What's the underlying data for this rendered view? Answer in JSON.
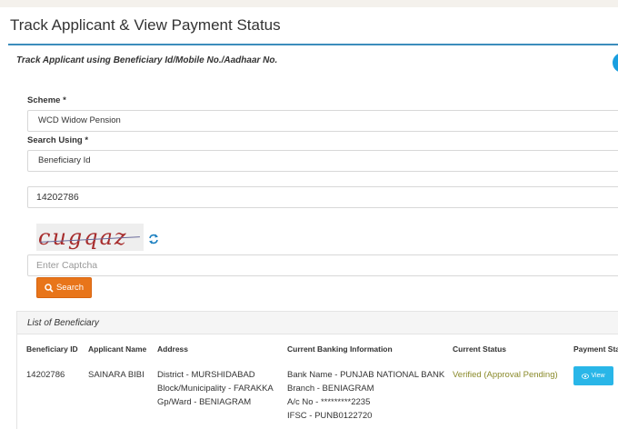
{
  "page": {
    "title": "Track Applicant & View Payment Status",
    "subheading": "Track Applicant using Beneficiary Id/Mobile No./Aadhaar No."
  },
  "form": {
    "scheme_label": "Scheme *",
    "scheme_value": "WCD Widow Pension",
    "search_using_label": "Search Using *",
    "search_using_value": "Beneficiary Id",
    "search_value": "14202786",
    "captcha_text": "cugqaz",
    "captcha_placeholder": "Enter Captcha",
    "search_button": "Search"
  },
  "results": {
    "heading": "List of Beneficiary",
    "columns": [
      "Beneficiary ID",
      "Applicant Name",
      "Address",
      "Current Banking Information",
      "Current Status",
      "Payment Sta"
    ],
    "rows": [
      {
        "beneficiary_id": "14202786",
        "applicant_name": "SAINARA BIBI",
        "address": [
          "District - MURSHIDABAD",
          "Block/Municipality - FARAKKA",
          "Gp/Ward - BENIAGRAM"
        ],
        "banking": [
          "Bank Name - PUNJAB NATIONAL BANK",
          "Branch - BENIAGRAM",
          "A/c No - *********2235",
          "IFSC - PUNB0122720"
        ],
        "status": "Verified (Approval Pending)",
        "view_button": "View"
      }
    ]
  },
  "colors": {
    "accent_line": "#3c8dbc",
    "search_button": "#e8751a",
    "view_button": "#29b6e8",
    "status_text": "#8a8a2a"
  }
}
